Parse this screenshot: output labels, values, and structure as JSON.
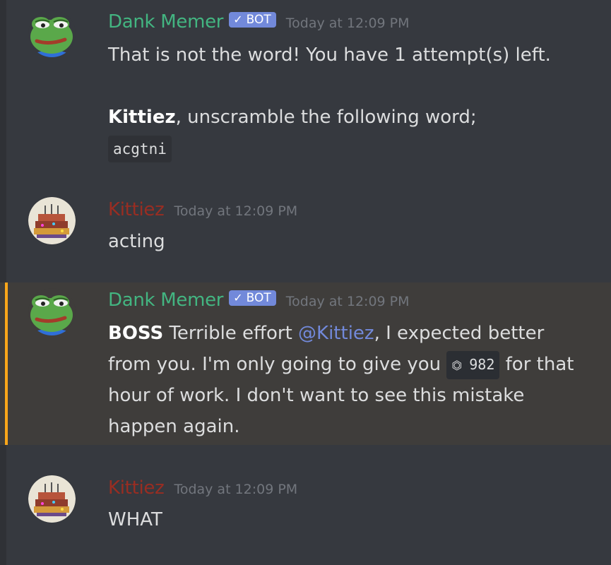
{
  "colors": {
    "background": "#36393f",
    "bot_name": "#43b581",
    "user_name": "#992d22",
    "bot_tag": "#7289da",
    "timestamp": "#72767d",
    "mention": "#7289da",
    "highlight_bar": "#faa61a"
  },
  "messages": [
    {
      "author": "Dank Memer",
      "bot_tag": "BOT",
      "timestamp": "Today at 12:09 PM",
      "line1": "That is not the word! You have 1 attempt(s) left.",
      "bold_name": "Kittiez",
      "line2_rest": ", unscramble the following word;",
      "code": "acgtni"
    },
    {
      "author": "Kittiez",
      "timestamp": "Today at 12:09 PM",
      "text": "acting"
    },
    {
      "author": "Dank Memer",
      "bot_tag": "BOT",
      "timestamp": "Today at 12:09 PM",
      "boss": "BOSS",
      "text_a": " Terrible effort ",
      "mention": "@Kittiez",
      "text_b": ", I expected better",
      "text_c": "from you. I'm only going to give you ",
      "coin_amount": "982",
      "text_d": " for that",
      "text_e": "hour of work. I don't want to see this mistake",
      "text_f": "happen again."
    },
    {
      "author": "Kittiez",
      "timestamp": "Today at 12:09 PM",
      "text": "WHAT"
    }
  ]
}
